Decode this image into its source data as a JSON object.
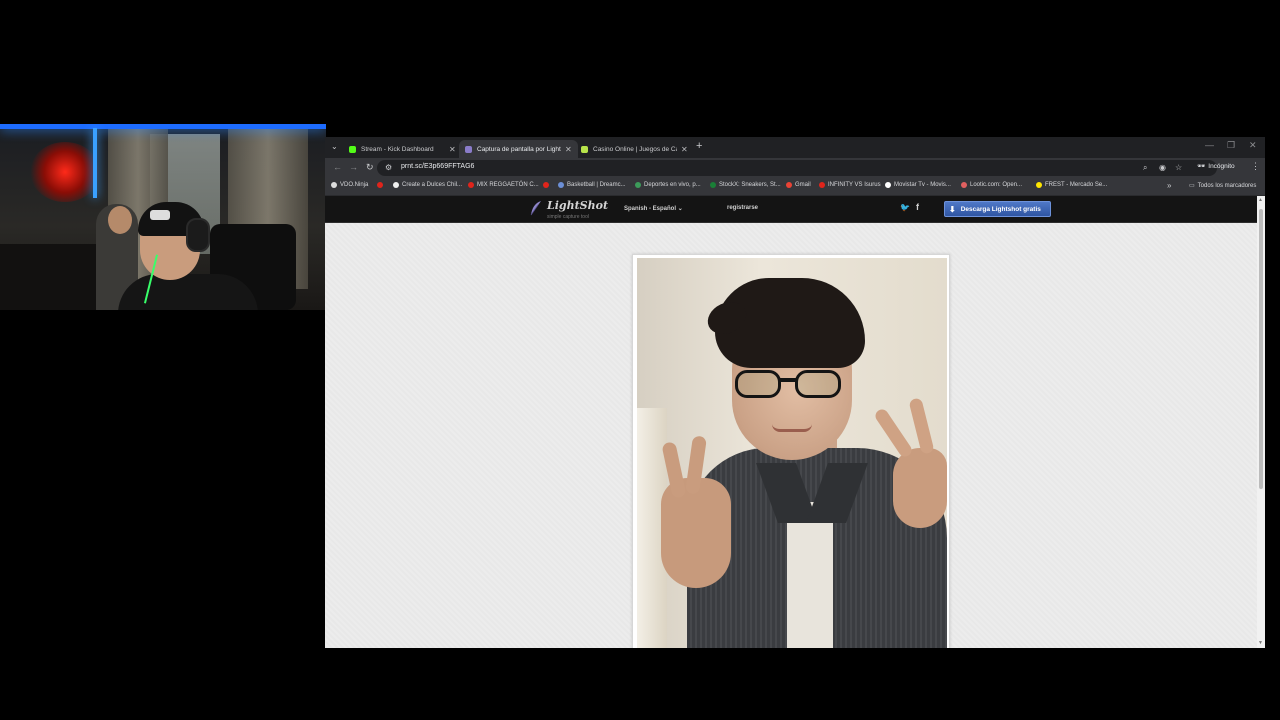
{
  "browser": {
    "tabs": [
      {
        "label": "Stream - Kick Dashboard",
        "favicon_color": "#53fc18"
      },
      {
        "label": "Captura de pantalla por Lightsh",
        "favicon_color": "#8a7cc9"
      },
      {
        "label": "Casino Online | Juegos de Casi",
        "favicon_color": "#b7e34a"
      }
    ],
    "url": "prnt.sc/E3p669FFTAG6",
    "incognito_label": "Incógnito",
    "bookmarks": [
      {
        "label": "VDO.Ninja",
        "color": "#dddddd"
      },
      {
        "label": "",
        "color": "#e0241b"
      },
      {
        "label": "Create a Dulces Chil...",
        "color": "#f0f0f0"
      },
      {
        "label": "MIX REGGAETÓN C...",
        "color": "#e0241b"
      },
      {
        "label": "",
        "color": "#e0241b"
      },
      {
        "label": "Basketball | Dreamc...",
        "color": "#6c8fd6"
      },
      {
        "label": "Deportes en vivo, p...",
        "color": "#3c9b5a"
      },
      {
        "label": "StockX: Sneakers, St...",
        "color": "#1a7f37"
      },
      {
        "label": "Gmail",
        "color": "#ea4335"
      },
      {
        "label": "INFINITY VS Isurus",
        "color": "#e0241b"
      },
      {
        "label": "Movistar Tv - Movis...",
        "color": "#ffffff"
      },
      {
        "label": "Lootic.com: Open...",
        "color": "#e06060"
      },
      {
        "label": "FREST - Mercado Se...",
        "color": "#ffe600"
      }
    ],
    "all_bookmarks_label": "Todos los marcadores"
  },
  "lightshot": {
    "logo": "LightShot",
    "slogan": "simple capture tool",
    "language": "Spanish - Español",
    "register": "registrarse",
    "download_button": "Descarga Lightshot gratis",
    "accent_color": "#3d64b3"
  }
}
